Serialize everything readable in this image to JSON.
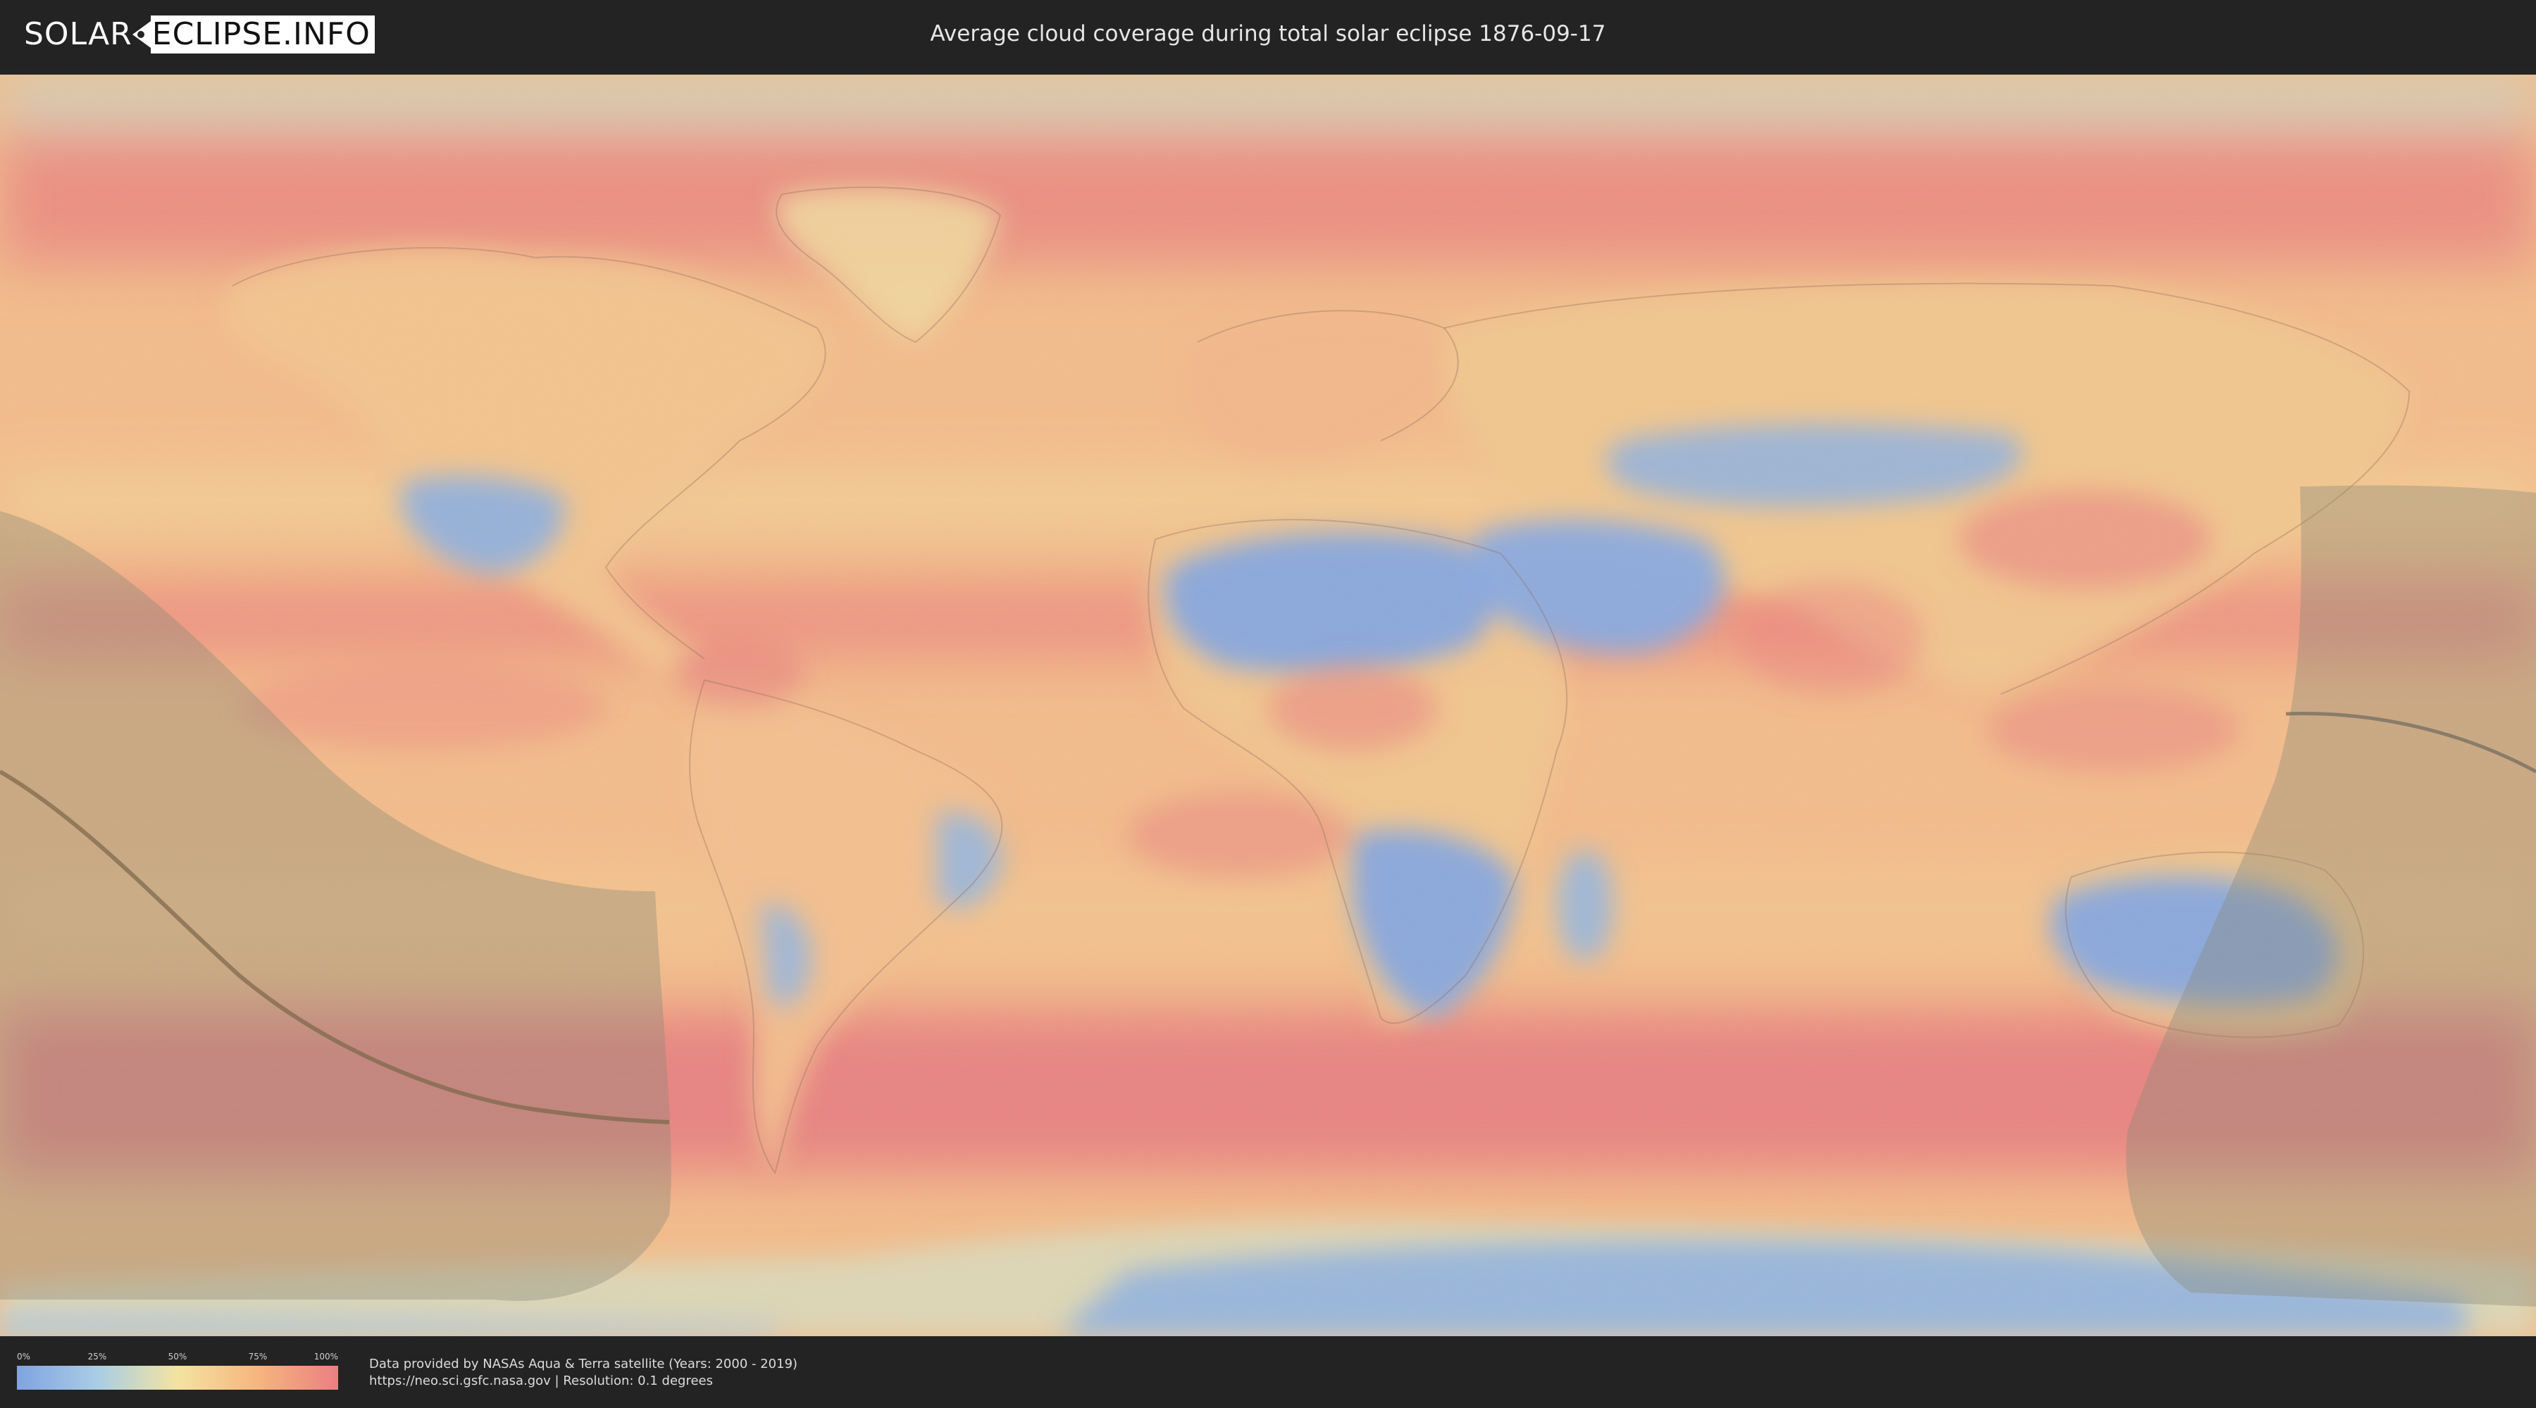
{
  "logo": {
    "part1": "SOLAR",
    "part2": "ECLIPSE.INFO"
  },
  "title": "Average cloud coverage during total solar eclipse 1876-09-17",
  "legend": {
    "ticks": [
      "0%",
      "25%",
      "50%",
      "75%",
      "100%"
    ],
    "colors": [
      "#7fa3e0",
      "#a9cde4",
      "#f4e3a1",
      "#f6b57e",
      "#ea7f82"
    ]
  },
  "credits": {
    "line1": "Data provided by NASAs Aqua & Terra satellite (Years: 2000 - 2019)",
    "line2": "https://neo.sci.gsfc.nasa.gov | Resolution: 0.1 degrees"
  },
  "map": {
    "ocean_color": "#f2b88a",
    "high_cloud_color": "#ea8582",
    "low_cloud_color": "#86a9df",
    "eclipse_zone_color": "#8a8a78"
  }
}
